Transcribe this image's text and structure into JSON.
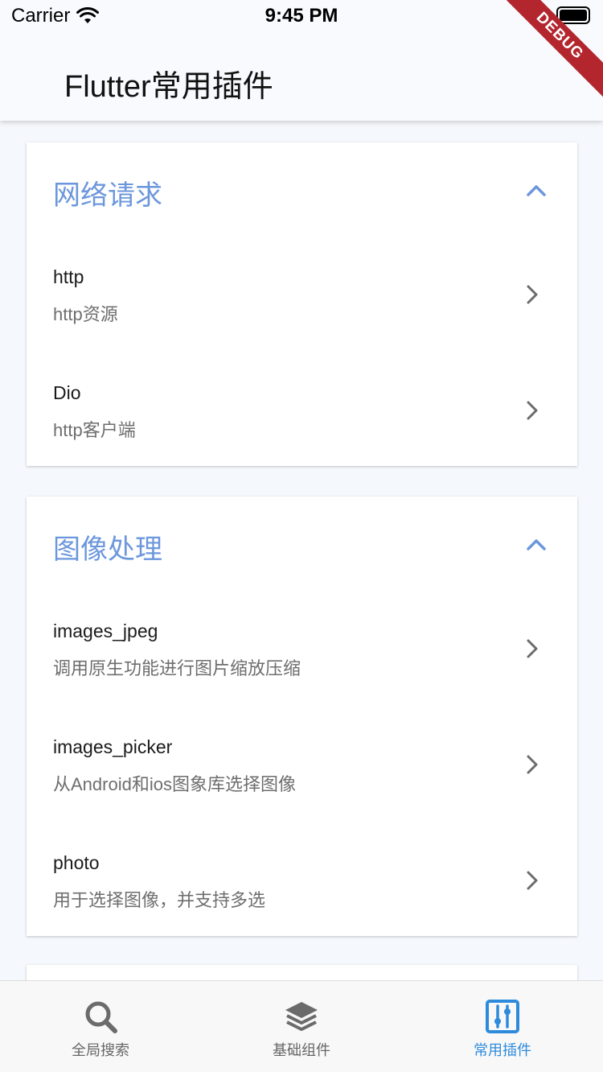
{
  "status_bar": {
    "carrier": "Carrier",
    "time": "9:45 PM"
  },
  "debug_banner": "DEBUG",
  "app_bar": {
    "title": "Flutter常用插件"
  },
  "sections": [
    {
      "title": "网络请求",
      "items": [
        {
          "title": "http",
          "subtitle": "http资源"
        },
        {
          "title": "Dio",
          "subtitle": "http客户端"
        }
      ]
    },
    {
      "title": "图像处理",
      "items": [
        {
          "title": "images_jpeg",
          "subtitle": "调用原生功能进行图片缩放压缩"
        },
        {
          "title": "images_picker",
          "subtitle": "从Android和ios图象库选择图像"
        },
        {
          "title": "photo",
          "subtitle": "用于选择图像，并支持多选"
        }
      ]
    }
  ],
  "bottom_nav": {
    "items": [
      {
        "label": "全局搜索",
        "icon": "search-icon"
      },
      {
        "label": "基础组件",
        "icon": "layers-icon"
      },
      {
        "label": "常用插件",
        "icon": "sliders-icon",
        "active": true
      }
    ]
  },
  "colors": {
    "accent": "#6c97dc",
    "active_tab": "#2e8bdc",
    "debug": "#b3262e"
  }
}
